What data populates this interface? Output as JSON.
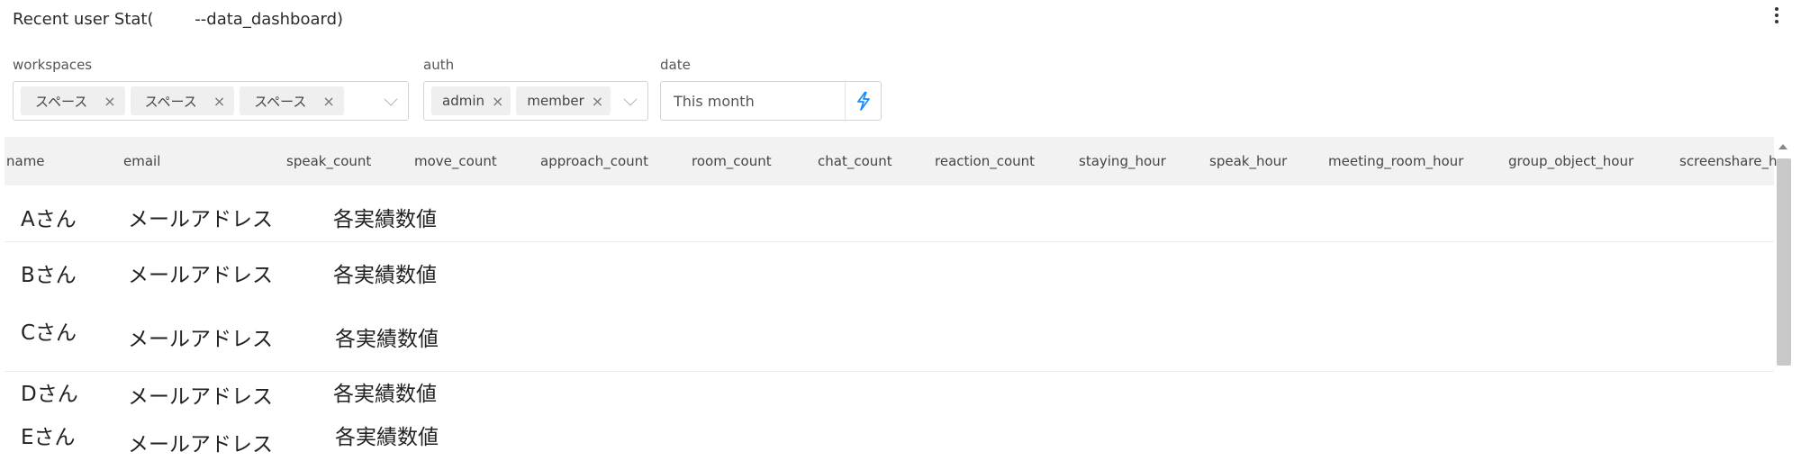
{
  "header": {
    "title": "Recent user Stat(        --data_dashboard)",
    "more_icon": "more-vertical-icon"
  },
  "filters": {
    "workspaces": {
      "label": "workspaces",
      "chips": [
        "スペース",
        "スペース",
        "スペース"
      ]
    },
    "auth": {
      "label": "auth",
      "chips": [
        "admin",
        "member"
      ]
    },
    "date": {
      "label": "date",
      "value": "This month",
      "action_icon": "lightning-bolt-icon",
      "accent": "#1a8cff"
    }
  },
  "table": {
    "columns": [
      "name",
      "email",
      "speak_count",
      "move_count",
      "approach_count",
      "room_count",
      "chat_count",
      "reaction_count",
      "staying_hour",
      "speak_hour",
      "meeting_room_hour",
      "group_object_hour",
      "screenshare_h"
    ],
    "rows": [
      {
        "name": "Aさん",
        "email": "メールアドレス",
        "value": "各実績数値"
      },
      {
        "name": "Bさん",
        "email": "メールアドレス",
        "value": "各実績数値"
      },
      {
        "name": "Cさん",
        "email": "メールアドレス",
        "value": "各実績数値"
      },
      {
        "name": "Dさん",
        "email": "メールアドレス",
        "value": "各実績数値"
      },
      {
        "name": "Eさん",
        "email": "メールアドレス",
        "value": "各実績数値"
      }
    ]
  }
}
